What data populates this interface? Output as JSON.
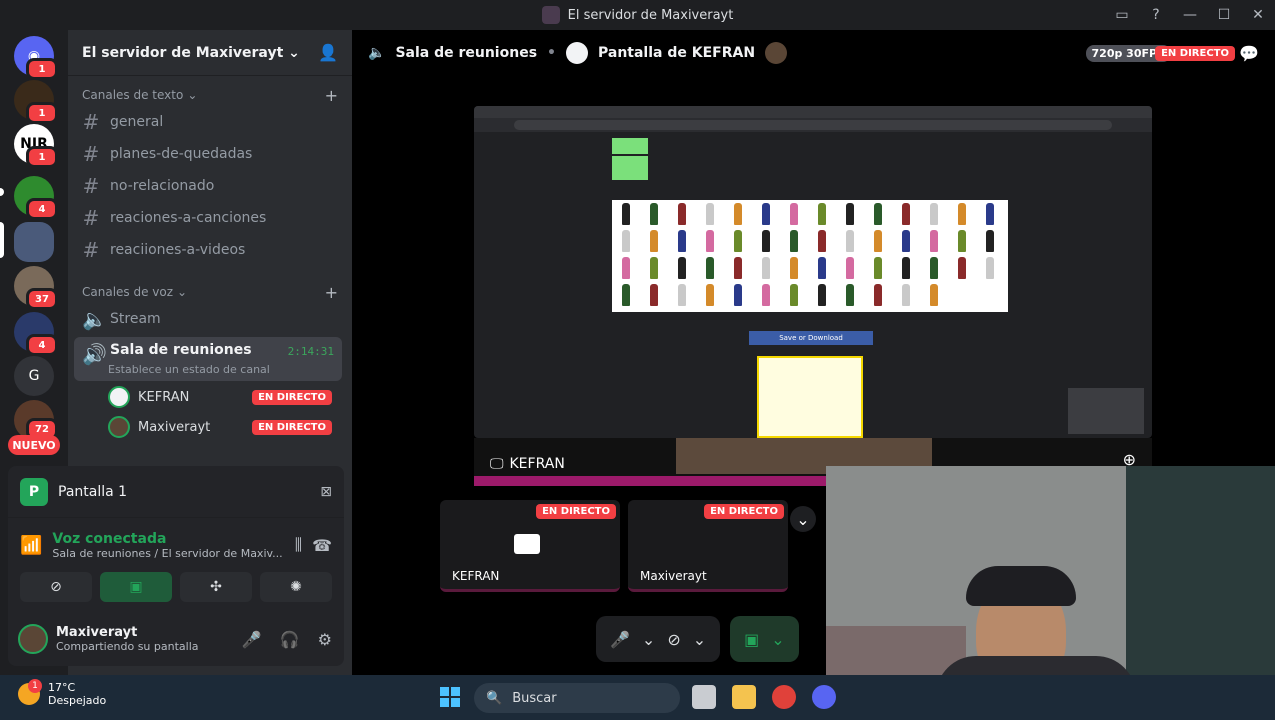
{
  "window": {
    "title": "El servidor de Maxiverayt"
  },
  "servers": {
    "badges": [
      "1",
      "1",
      "1",
      "4",
      "37",
      "4",
      "72"
    ],
    "letter": "G",
    "nuevo": "NUEVO",
    "nir": "NIR"
  },
  "sidebar": {
    "server_name": "El servidor de Maxiverayt",
    "text_category": "Canales de texto",
    "text_channels": [
      "general",
      "planes-de-quedadas",
      "no-relacionado",
      "reaciones-a-canciones",
      "reaciiones-a-videos"
    ],
    "voice_category": "Canales de voz",
    "voice_channels": [
      "Stream"
    ],
    "active_voice": {
      "name": "Sala de reuniones",
      "timer": "2:14:31",
      "status": "Establece un estado de canal"
    },
    "voice_users": [
      {
        "name": "KEFRAN",
        "badge": "EN DIRECTO"
      },
      {
        "name": "Maxiverayt",
        "badge": "EN DIRECTO"
      }
    ]
  },
  "panel": {
    "screen_label": "Pantalla 1",
    "screen_letter": "P",
    "voice_title": "Voz conectada",
    "voice_sub": "Sala de reuniones / El servidor de Maxiv...",
    "user_name": "Maxiverayt",
    "user_status": "Compartiendo su pantalla"
  },
  "stage": {
    "channel": "Sala de reuniones",
    "stream_title": "Pantalla de KEFRAN",
    "quality": "720p 30FPS",
    "live": "EN DIRECTO",
    "main_label": "KEFRAN",
    "shared_button": "Save or Download",
    "thumbs": [
      {
        "label": "KEFRAN",
        "live": "EN DIRECTO"
      },
      {
        "label": "Maxiverayt",
        "live": "EN DIRECTO"
      }
    ]
  },
  "taskbar": {
    "temp": "17°C",
    "weather": "Despejado",
    "search": "Buscar",
    "weather_badge": "1"
  }
}
